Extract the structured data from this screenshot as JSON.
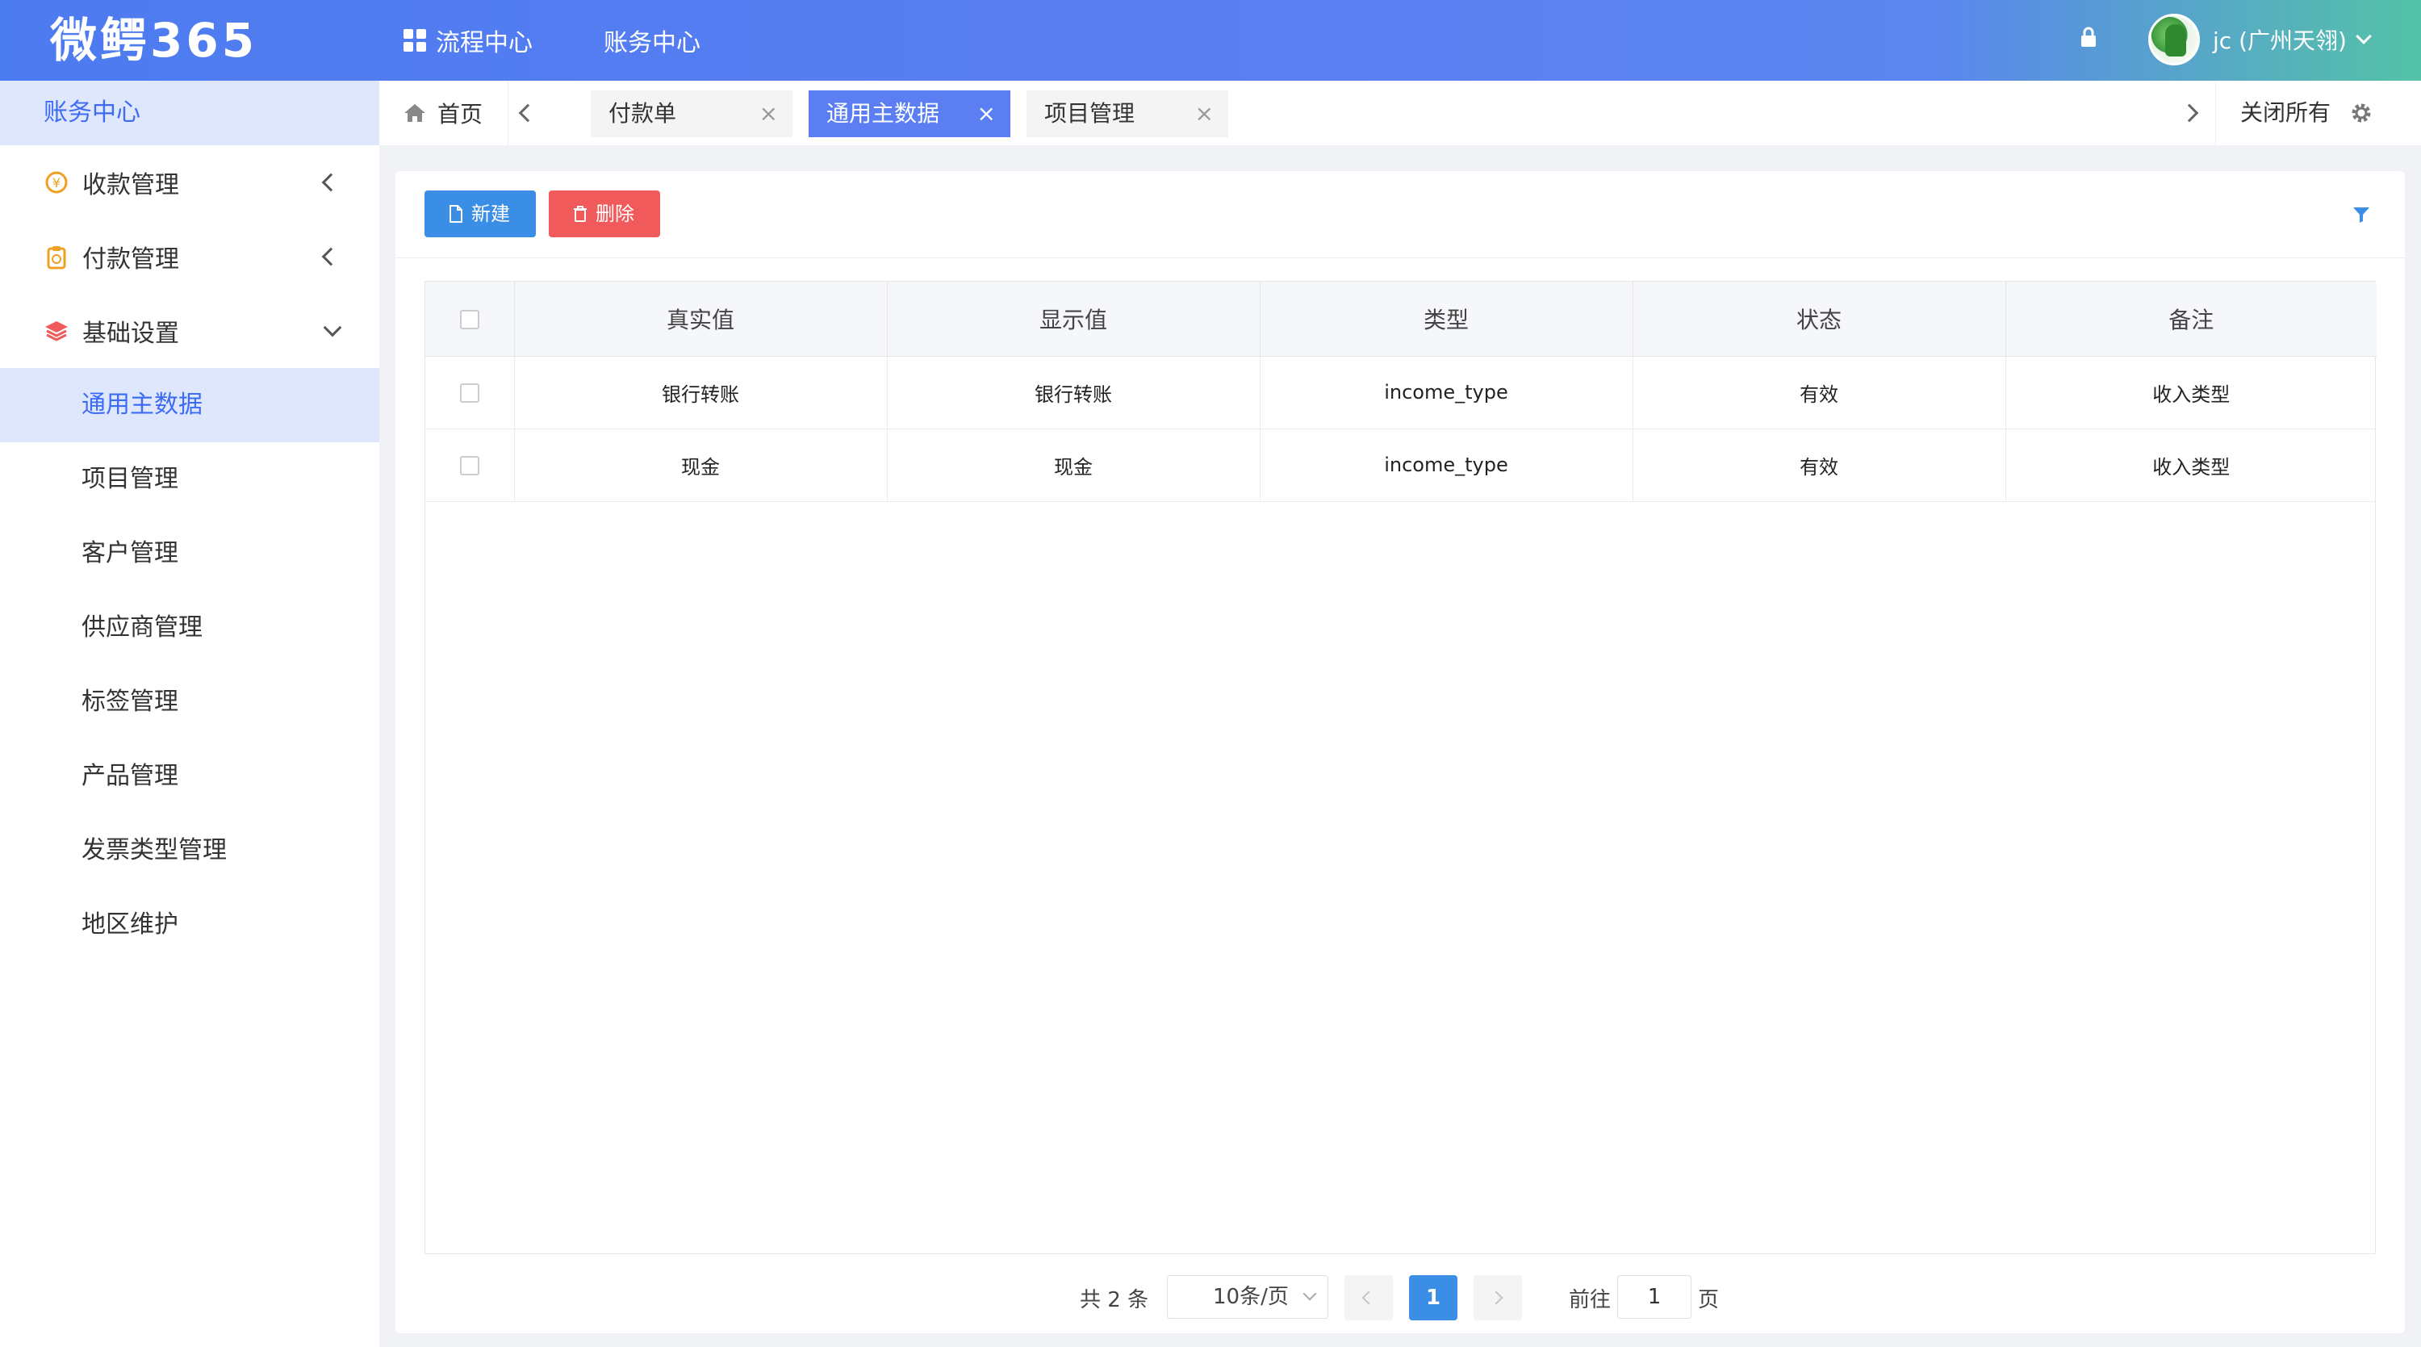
{
  "app": {
    "logo": "微鳄365"
  },
  "topnav": [
    {
      "label": "流程中心",
      "icon": "grid-icon"
    },
    {
      "label": "账务中心"
    }
  ],
  "user": {
    "name": "jc (广州天翎)"
  },
  "sidebar": {
    "title": "账务中心",
    "groups": [
      {
        "label": "收款管理",
        "icon": "coin-icon",
        "color": "#f0a020"
      },
      {
        "label": "付款管理",
        "icon": "clipboard-icon",
        "color": "#f0a020"
      },
      {
        "label": "基础设置",
        "icon": "layers-icon",
        "color": "#f05a5a"
      }
    ],
    "items": [
      "通用主数据",
      "项目管理",
      "客户管理",
      "供应商管理",
      "标签管理",
      "产品管理",
      "发票类型管理",
      "地区维护"
    ]
  },
  "tabs": {
    "home": "首页",
    "items": [
      {
        "label": "付款单",
        "close": "×"
      },
      {
        "label": "通用主数据",
        "close": "×"
      },
      {
        "label": "项目管理",
        "close": "×"
      }
    ],
    "close_all": "关闭所有"
  },
  "toolbar": {
    "new_label": "新建",
    "delete_label": "删除"
  },
  "table": {
    "headers": [
      "真实值",
      "显示值",
      "类型",
      "状态",
      "备注"
    ],
    "rows": [
      [
        "银行转账",
        "银行转账",
        "income_type",
        "有效",
        "收入类型"
      ],
      [
        "现金",
        "现金",
        "income_type",
        "有效",
        "收入类型"
      ]
    ]
  },
  "pagination": {
    "total": "共 2 条",
    "page_size": "10条/页",
    "current": "1",
    "goto_label": "前往",
    "goto_value": "1",
    "page_suffix": "页"
  },
  "colors": {
    "primary": "#3a8ee6",
    "danger": "#f05a5a",
    "accent": "#5b7ff2"
  }
}
